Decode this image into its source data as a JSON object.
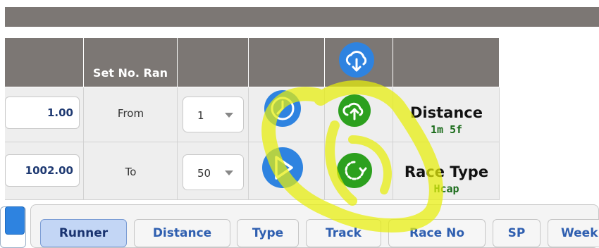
{
  "header": {
    "set_no_ran": "Set No. Ran"
  },
  "rows": [
    {
      "value": "1.00",
      "label": "From",
      "select_value": "1"
    },
    {
      "value": "1002.00",
      "label": "To",
      "select_value": "50"
    }
  ],
  "stats": [
    {
      "title": "Distance",
      "value": "1m 5f"
    },
    {
      "title": "Race Type",
      "value": "Hcap"
    }
  ],
  "icons": {
    "header": "cloud-download-icon",
    "row1_left": "clock-icon",
    "row1_right": "cloud-upload-icon",
    "row2_left": "play-icon",
    "row2_right": "refresh-icon"
  },
  "tabs": [
    {
      "label": "Runner",
      "active": true
    },
    {
      "label": "Distance"
    },
    {
      "label": "Type"
    },
    {
      "label": "Track"
    },
    {
      "label": "Race No"
    },
    {
      "label": "SP"
    },
    {
      "label": "Week"
    }
  ],
  "colors": {
    "header_bg": "#7c7774",
    "blue_icon": "#2e83e0",
    "green_icon": "#2ca01e",
    "highlight": "#e8ee0a"
  }
}
